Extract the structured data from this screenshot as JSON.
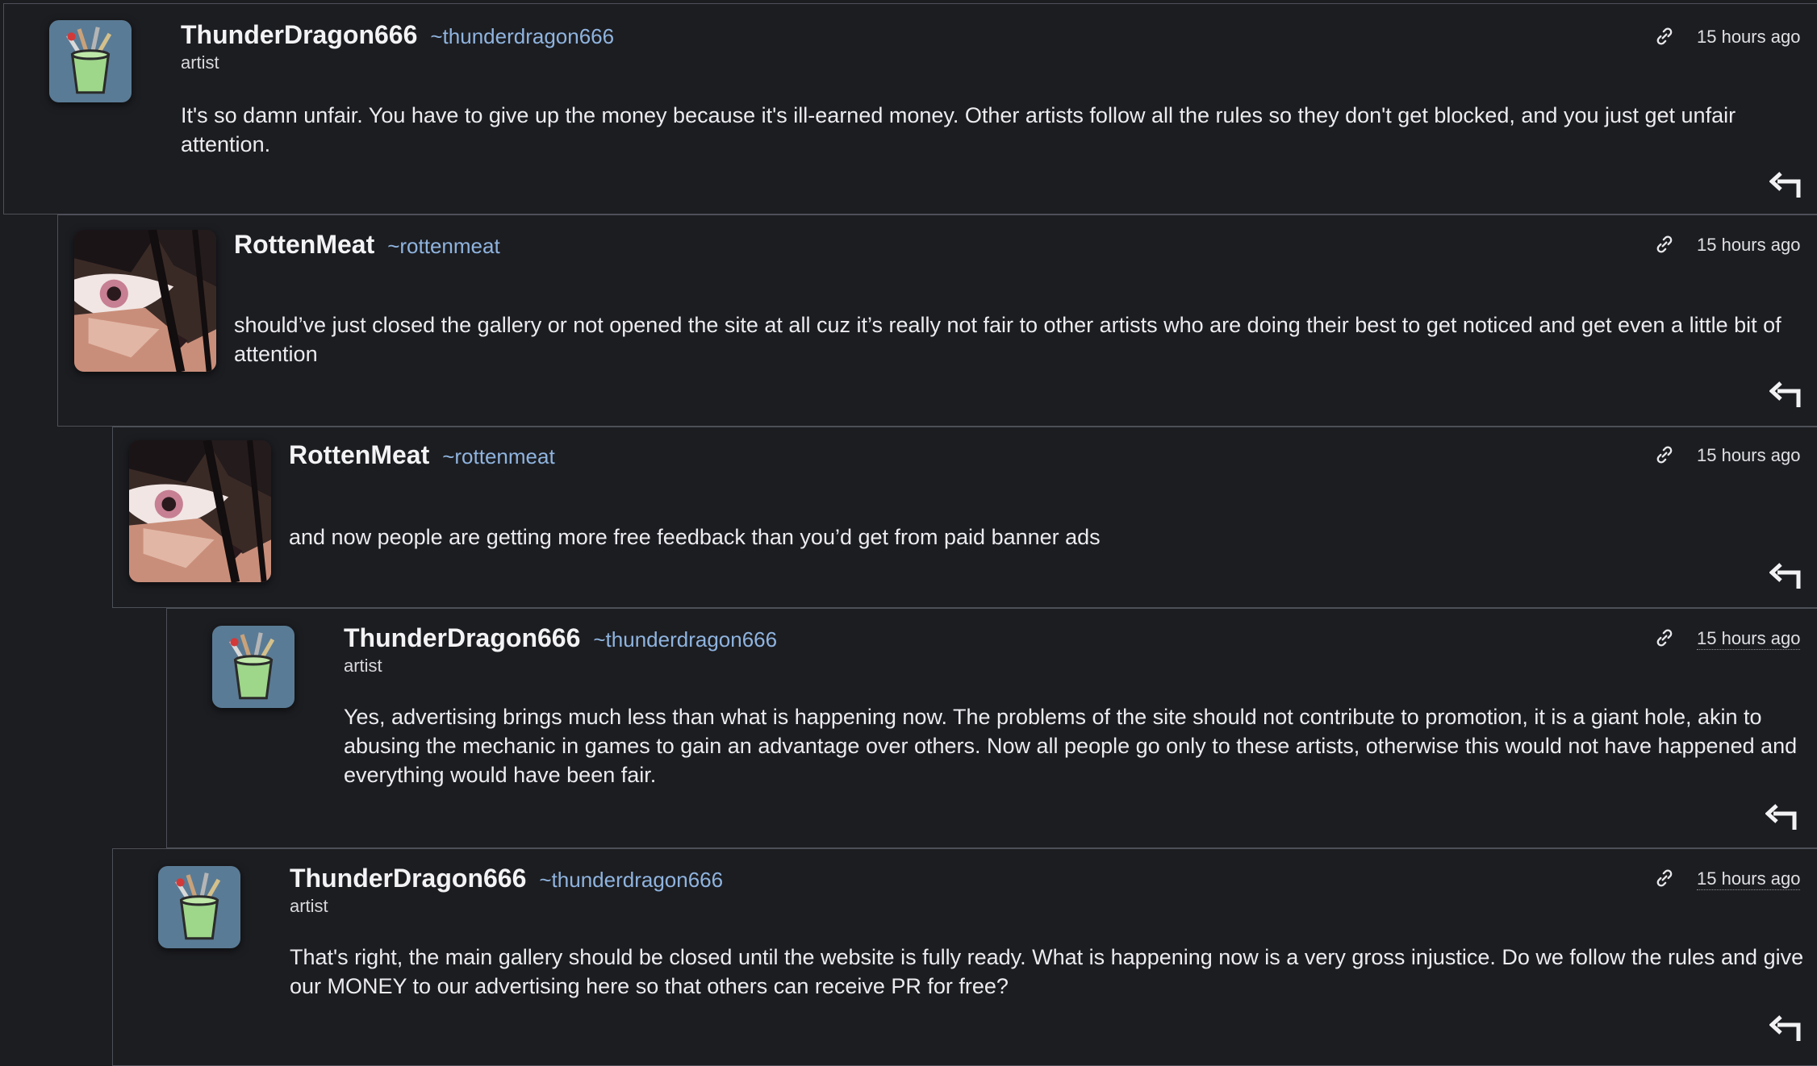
{
  "comments": [
    {
      "avatar": "artist-brushes-avatar",
      "display_name": "ThunderDragon666",
      "username": "~thunderdragon666",
      "role": "artist",
      "timestamp": "15 hours ago",
      "text": "It's so damn unfair. You have to give up the money because it's ill-earned money. Other artists follow all the rules so they don't get blocked, and you just get unfair attention."
    },
    {
      "avatar": "anime-eye-avatar",
      "display_name": "RottenMeat",
      "username": "~rottenmeat",
      "role": "",
      "timestamp": "15 hours ago",
      "text": "should’ve just closed the gallery or not opened the site at all cuz it’s really not fair to other artists who are doing their best to get noticed and get even a little bit of attention"
    },
    {
      "avatar": "anime-eye-avatar",
      "display_name": "RottenMeat",
      "username": "~rottenmeat",
      "role": "",
      "timestamp": "15 hours ago",
      "text": "and now people are getting more free feedback than you’d get from paid banner ads"
    },
    {
      "avatar": "artist-brushes-avatar",
      "display_name": "ThunderDragon666",
      "username": "~thunderdragon666",
      "role": "artist",
      "timestamp": "15 hours ago",
      "text": "Yes, advertising brings much less than what is happening now. The problems of the site should not contribute to promotion, it is a giant hole, akin to abusing the mechanic in games to gain an advantage over others. Now all people go only to these artists, otherwise this would not have happened and everything would have been fair."
    },
    {
      "avatar": "artist-brushes-avatar",
      "display_name": "ThunderDragon666",
      "username": "~thunderdragon666",
      "role": "artist",
      "timestamp": "15 hours ago",
      "text": "That's right, the main gallery should be closed until the website is fully ready. What is happening now is a very gross injustice. Do we follow the rules and give our MONEY to our advertising here so that others can receive PR for free?"
    }
  ],
  "icons": {
    "link": "link-icon",
    "reply": "reply-arrow-icon"
  },
  "colors": {
    "background": "#1c1d21",
    "border": "#4d5057",
    "username": "#8fb4df",
    "avatar_artist_bg": "#5a7b95"
  }
}
